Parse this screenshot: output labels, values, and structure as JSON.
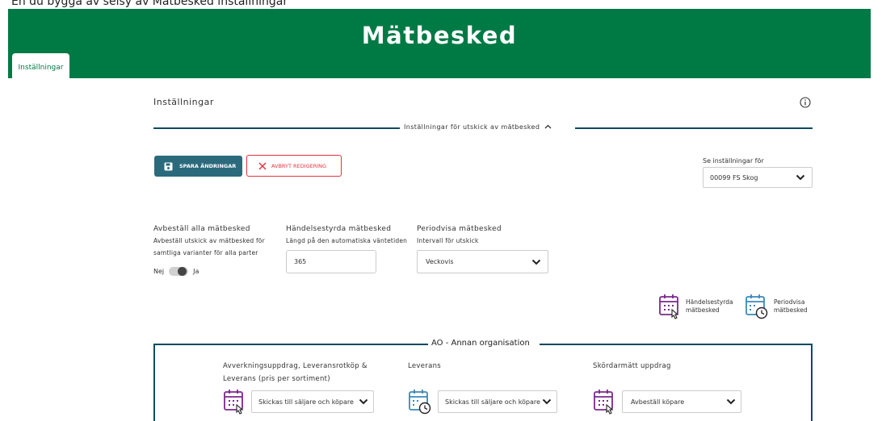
{
  "clipped_heading": "En du bygga av selsy av Mätbesked inställningar",
  "header": {
    "title": "Mätbesked",
    "tab_label": "Inställningar"
  },
  "page": {
    "section_title": "Inställningar"
  },
  "divider": {
    "label": "Inställningar för utskick av mätbesked"
  },
  "actions": {
    "save_label": "SPARA ÄNDRINGAR",
    "cancel_label": "AVBRYT REDIGERING"
  },
  "view_for": {
    "label": "Se inställningar för",
    "selected": "00099 FS Skog"
  },
  "columns": {
    "cancel_all": {
      "heading": "Avbeställ alla mätbesked",
      "description_line1": "Avbeställ utskick av mätbesked för",
      "description_line2": "samtliga varianter för alla parter",
      "toggle_off": "Nej",
      "toggle_on": "Ja"
    },
    "event_driven": {
      "heading": "Händelsestyrda mätbesked",
      "description": "Längd på den automatiska väntetiden",
      "value": "365"
    },
    "periodic": {
      "heading": "Periodvisa mätbesked",
      "description": "Intervall för utskick",
      "selected": "Veckovis"
    }
  },
  "legend": {
    "event_line1": "Händelsestyrda",
    "event_line2": "mätbesked",
    "periodic_line1": "Periodvisa",
    "periodic_line2": "mätbesked"
  },
  "ao": {
    "label": "AO - Annan organisation",
    "col1_line1": "Avverkningsuppdrag, Leveransrotköp &",
    "col1_line2": "Leverans (pris per sortiment)",
    "col1_selected": "Skickas till säljare och köpare",
    "col2_head": "Leverans",
    "col2_selected": "Skickas till säljare och köpare",
    "col3_head": "Skördarmätt uppdrag",
    "col3_selected": "Avbeställ köpare"
  },
  "colors": {
    "header_green": "#007a45",
    "teal": "#0d4a5e",
    "save_button": "#2a6a7c",
    "cancel_red": "#e0343c",
    "event_purple": "#7a2a8a",
    "periodic_blue": "#3a8ab8"
  }
}
